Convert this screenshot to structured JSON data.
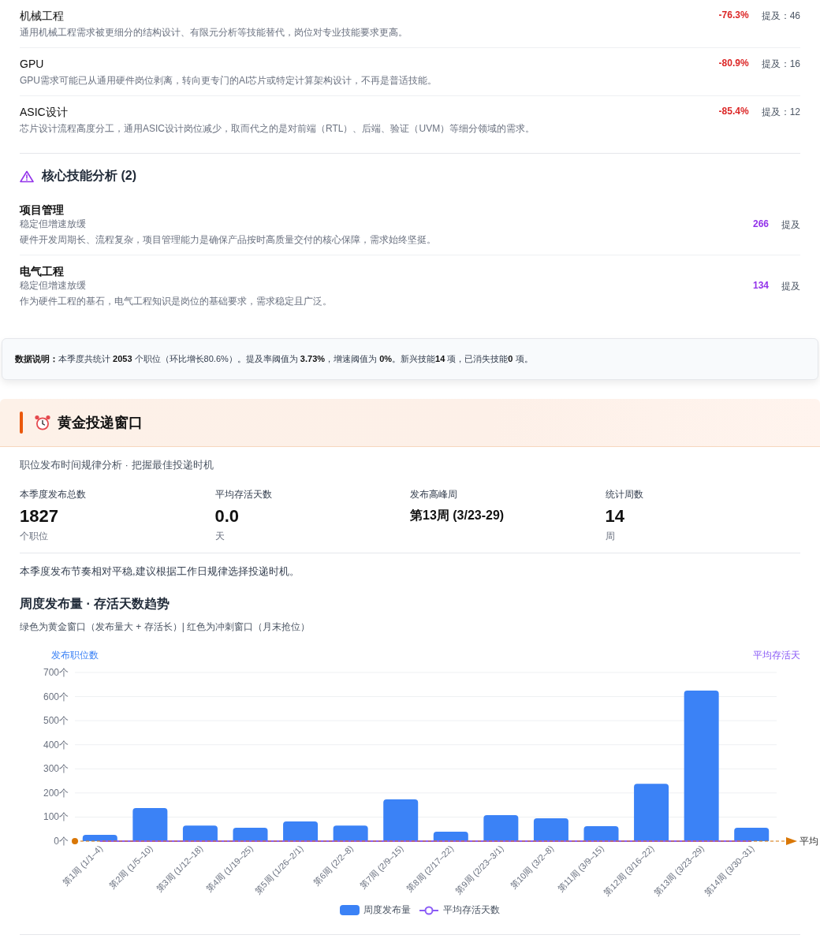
{
  "declining_skills": [
    {
      "name": "机械工程",
      "description": "通用机械工程需求被更细分的结构设计、有限元分析等技能替代，岗位对专业技能要求更高。",
      "change": "-76.3%",
      "mentions": "提及：46"
    },
    {
      "name": "GPU",
      "description": "GPU需求可能已从通用硬件岗位剥离，转向更专门的AI芯片或特定计算架构设计，不再是普适技能。",
      "change": "-80.9%",
      "mentions": "提及：16"
    },
    {
      "name": "ASIC设计",
      "description": "芯片设计流程高度分工，通用ASIC设计岗位减少，取而代之的是对前端（RTL）、后端、验证（UVM）等细分领域的需求。",
      "change": "-85.4%",
      "mentions": "提及：12"
    }
  ],
  "core_skills": {
    "title": "核心技能分析 (2)",
    "items": [
      {
        "name": "项目管理",
        "status": "稳定但增速放缓",
        "description": "硬件开发周期长、流程复杂，项目管理能力是确保产品按时高质量交付的核心保障，需求始终坚挺。",
        "count": "266",
        "unit": "提及"
      },
      {
        "name": "电气工程",
        "status": "稳定但增速放缓",
        "description": "作为硬件工程的基石，电气工程知识是岗位的基础要求，需求稳定且广泛。",
        "count": "134",
        "unit": "提及"
      }
    ]
  },
  "data_note": "**数据说明：**本季度共统计 **2053** 个职位（环比增长80.6%）。提及率阈值为 **3.73%**，增速阈值为 **0%**。新兴技能**14** 项，已消失技能**0** 项。",
  "golden_window": {
    "title": "黄金投递窗口",
    "subtitle": "职位发布时间规律分析 · 把握最佳投递时机",
    "stats": [
      {
        "label": "本季度发布总数",
        "value": "1827",
        "unit": "个职位"
      },
      {
        "label": "平均存活天数",
        "value": "0.0",
        "unit": "天"
      },
      {
        "label": "发布高峰周",
        "value": "第13周 (3/23-29)"
      },
      {
        "label": "统计周数",
        "value": "14",
        "unit": "周"
      }
    ],
    "summary": "本季度发布节奏相对平稳,建议根据工作日规律选择投递时机。",
    "chart_title": "周度发布量 · 存活天数趋势",
    "chart_caption": "绿色为黄金窗口（发布量大 + 存活长）| 红色为冲刺窗口（月末抢位）",
    "chart_data": {
      "type": "bar",
      "ylabel": "发布职位数",
      "y2label": "平均存活天",
      "categories": [
        "第1周 (1/1–4)",
        "第2周 (1/5–10)",
        "第3周 (1/12–18)",
        "第4周 (1/19–25)",
        "第5周 (1/26–2/1)",
        "第6周 (2/2–8)",
        "第7周 (2/9–15)",
        "第8周 (2/17–22)",
        "第9周 (2/23–3/1)",
        "第10周 (3/2–8)",
        "第11周 (3/9–15)",
        "第12周 (3/16–22)",
        "第13周 (3/23–29)",
        "第14周 (3/30–31)"
      ],
      "series": [
        {
          "name": "周度发布量",
          "color": "#3b82f6",
          "values": [
            26,
            137,
            65,
            56,
            82,
            65,
            173,
            39,
            108,
            95,
            62,
            238,
            625,
            56
          ]
        },
        {
          "name": "平均存活天数",
          "color": "#8b5cf6",
          "values": [
            0,
            0,
            0,
            0,
            0,
            0,
            0,
            0,
            0,
            0,
            0,
            0,
            0,
            0
          ]
        }
      ],
      "ylim": [
        0,
        700
      ],
      "yticks": [
        {
          "value": 0,
          "label": "0个"
        },
        {
          "value": 100,
          "label": "100个"
        },
        {
          "value": 200,
          "label": "200个"
        },
        {
          "value": 300,
          "label": "300个"
        },
        {
          "value": 400,
          "label": "400个"
        },
        {
          "value": 500,
          "label": "500个"
        },
        {
          "value": 600,
          "label": "600个"
        },
        {
          "value": 700,
          "label": "700个"
        }
      ],
      "grid": true,
      "ref_lines": [
        {
          "axis": "y",
          "value": 0,
          "label": "平均",
          "color": "#d97706"
        }
      ]
    }
  }
}
